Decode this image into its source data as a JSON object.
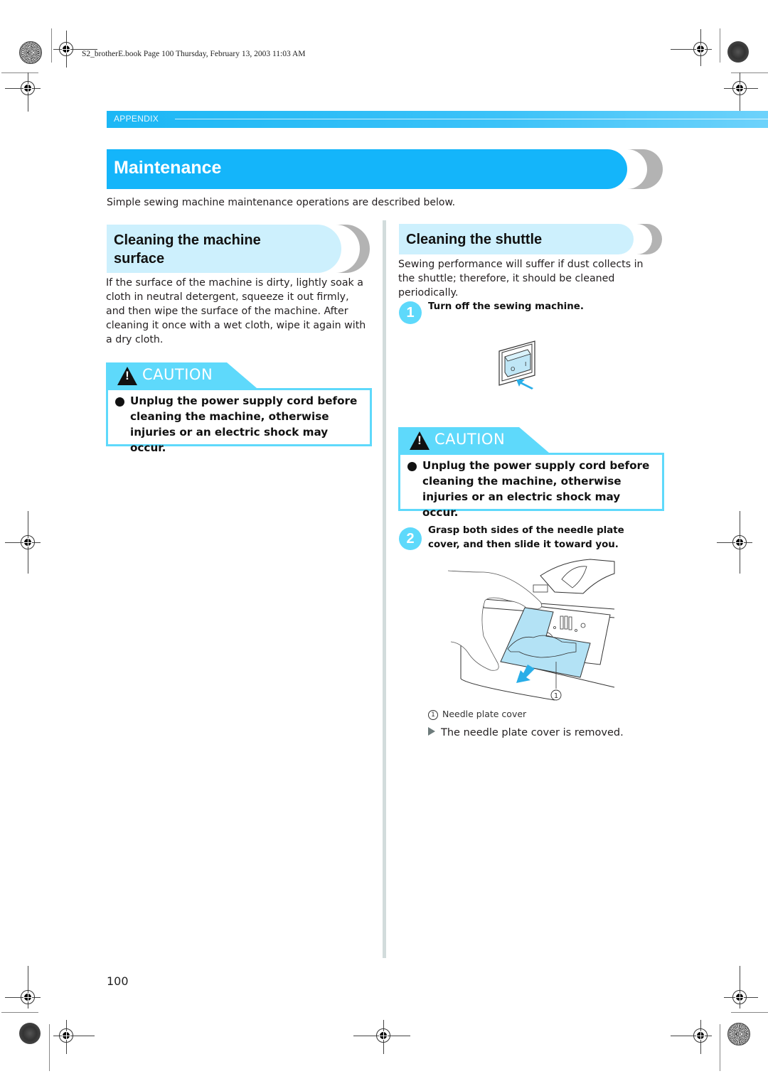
{
  "print_info": "S2_brotherE.book  Page 100  Thursday, February 13, 2003  11:03 AM",
  "header": {
    "section_label": "APPENDIX"
  },
  "title": "Maintenance",
  "intro": "Simple sewing machine maintenance operations are described below.",
  "left_column": {
    "heading_line1": "Cleaning the machine",
    "heading_line2": "surface",
    "body": "If the surface of the machine is dirty, lightly soak a cloth in neutral detergent, squeeze it out firmly, and then wipe the surface of the machine. After cleaning it once with a wet cloth, wipe it again with a dry cloth.",
    "caution": {
      "icon": "warning-triangle-icon",
      "label": "CAUTION",
      "message": "Unplug the power supply cord before cleaning the machine, otherwise injuries or an electric shock may occur."
    }
  },
  "right_column": {
    "heading": "Cleaning the shuttle",
    "body": "Sewing performance will suffer if dust collects in the shuttle; therefore, it should be cleaned periodically.",
    "steps": [
      {
        "number": "1",
        "text": "Turn off the sewing machine.",
        "illustration": "power-switch-icon"
      },
      {
        "number": "2",
        "text": "Grasp both sides of the needle plate cover, and then slide it toward you.",
        "illustration": "needle-plate-cover-illustration"
      }
    ],
    "caution": {
      "icon": "warning-triangle-icon",
      "label": "CAUTION",
      "message": "Unplug the power supply cord before cleaning the machine, otherwise injuries or an electric shock may occur."
    },
    "switch_labels": {
      "off": "O",
      "on": "I"
    },
    "callout_number": "1",
    "legend": {
      "number": "1",
      "label": "Needle plate cover"
    },
    "result": "The needle plate cover is removed."
  },
  "page_number": "100",
  "colors": {
    "accent_blue": "#14b5fa",
    "light_blue": "#cdf0fd",
    "caution_cyan": "#5ed9fb",
    "gray_tab": "#b3b3b3"
  }
}
